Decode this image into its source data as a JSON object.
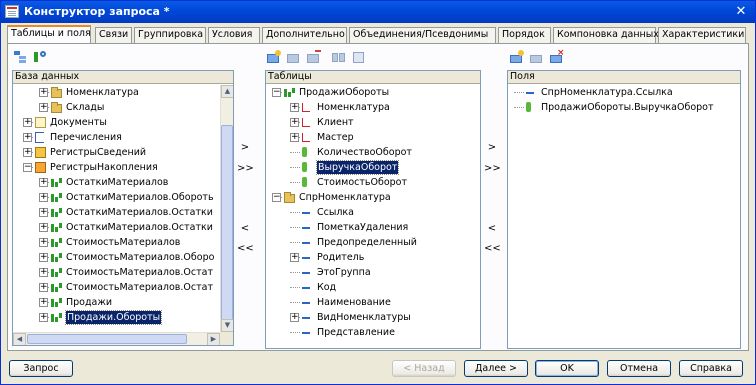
{
  "window": {
    "title": "Конструктор запроса *"
  },
  "tabs": [
    {
      "label": "Таблицы и поля",
      "active": true
    },
    {
      "label": "Связи"
    },
    {
      "label": "Группировка"
    },
    {
      "label": "Условия"
    },
    {
      "label": "Дополнительно"
    },
    {
      "label": "Объединения/Псевдонимы"
    },
    {
      "label": "Порядок"
    },
    {
      "label": "Компоновка данных"
    },
    {
      "label": "Характеристики"
    }
  ],
  "database_pane": {
    "header": "База данных",
    "rows": [
      {
        "label": "Номенклатура",
        "icon": "folder",
        "level": 2,
        "expand": "+"
      },
      {
        "label": "Склады",
        "icon": "folder",
        "level": 2,
        "expand": "+"
      },
      {
        "label": "Документы",
        "icon": "doc",
        "level": 1,
        "expand": "+"
      },
      {
        "label": "Перечисления",
        "icon": "enum",
        "level": 1,
        "expand": "+"
      },
      {
        "label": "РегистрыСведений",
        "icon": "info",
        "level": 1,
        "expand": "+"
      },
      {
        "label": "РегистрыНакопления",
        "icon": "acc",
        "level": 1,
        "expand": "-"
      },
      {
        "label": "ОстаткиМатериалов",
        "icon": "reg",
        "level": 2,
        "expand": "+"
      },
      {
        "label": "ОстаткиМатериалов.Обороть",
        "icon": "reg",
        "level": 2,
        "expand": "+"
      },
      {
        "label": "ОстаткиМатериалов.Остатки",
        "icon": "reg",
        "level": 2,
        "expand": "+"
      },
      {
        "label": "ОстаткиМатериалов.Остатки",
        "icon": "reg",
        "level": 2,
        "expand": "+"
      },
      {
        "label": "СтоимостьМатериалов",
        "icon": "reg",
        "level": 2,
        "expand": "+"
      },
      {
        "label": "СтоимостьМатериалов.Оборо",
        "icon": "reg",
        "level": 2,
        "expand": "+"
      },
      {
        "label": "СтоимостьМатериалов.Остат",
        "icon": "reg",
        "level": 2,
        "expand": "+"
      },
      {
        "label": "СтоимостьМатериалов.Остат",
        "icon": "reg",
        "level": 2,
        "expand": "+"
      },
      {
        "label": "Продажи",
        "icon": "reg",
        "level": 2,
        "expand": "+"
      },
      {
        "label": "Продажи.Обороты",
        "icon": "reg",
        "level": 2,
        "expand": "+",
        "selected": true
      }
    ]
  },
  "tables_pane": {
    "header": "Таблицы",
    "rows": [
      {
        "label": "ПродажиОбороты",
        "icon": "reg",
        "level": 1,
        "expand": "-"
      },
      {
        "label": "Номенклатура",
        "icon": "link",
        "level": 2,
        "expand": "+"
      },
      {
        "label": "Клиент",
        "icon": "link",
        "level": 2,
        "expand": "+"
      },
      {
        "label": "Мастер",
        "icon": "link",
        "level": 2,
        "expand": "+"
      },
      {
        "label": "КоличествоОборот",
        "icon": "field",
        "level": 2
      },
      {
        "label": "ВыручкаОборот",
        "icon": "field",
        "level": 2,
        "selected": true
      },
      {
        "label": "СтоимостьОборот",
        "icon": "field",
        "level": 2
      },
      {
        "label": "СпрНоменклатура",
        "icon": "folder",
        "level": 1,
        "expand": "-"
      },
      {
        "label": "Ссылка",
        "icon": "dash",
        "level": 2
      },
      {
        "label": "ПометкаУдаления",
        "icon": "dash",
        "level": 2
      },
      {
        "label": "Предопределенный",
        "icon": "dash",
        "level": 2
      },
      {
        "label": "Родитель",
        "icon": "dash",
        "level": 2,
        "expand": "+"
      },
      {
        "label": "ЭтоГруппа",
        "icon": "dash",
        "level": 2
      },
      {
        "label": "Код",
        "icon": "dash",
        "level": 2
      },
      {
        "label": "Наименование",
        "icon": "dash",
        "level": 2
      },
      {
        "label": "ВидНоменклатуры",
        "icon": "dash",
        "level": 2,
        "expand": "+"
      },
      {
        "label": "Представление",
        "icon": "dash",
        "level": 2
      }
    ]
  },
  "fields_pane": {
    "header": "Поля",
    "rows": [
      {
        "label": "СпрНоменклатура.Ссылка",
        "icon": "dash"
      },
      {
        "label": "ПродажиОбороты.ВыручкаОборот",
        "icon": "field"
      }
    ]
  },
  "move_buttons": {
    "add_one": ">",
    "add_all": ">>",
    "remove_one": "<",
    "remove_all": "<<"
  },
  "bottom_buttons": {
    "query": "Запрос",
    "back": "< Назад",
    "next": "Далее >",
    "ok": "OK",
    "cancel": "Отмена",
    "help": "Справка"
  }
}
